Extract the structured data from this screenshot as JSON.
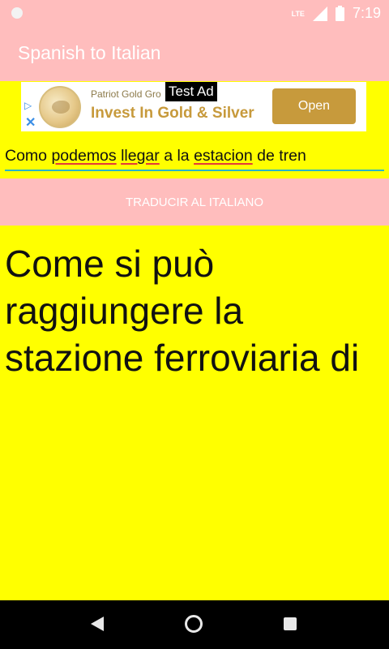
{
  "status_bar": {
    "time": "7:19",
    "network": "LTE"
  },
  "app_bar": {
    "title": "Spanish to Italian"
  },
  "ad": {
    "label": "Test Ad",
    "advertiser": "Patriot Gold Gro",
    "headline": "Invest In Gold & Silver",
    "cta": "Open"
  },
  "input": {
    "segments": [
      {
        "text": "Como ",
        "misspelled": false
      },
      {
        "text": "podemos",
        "misspelled": true
      },
      {
        "text": " ",
        "misspelled": false
      },
      {
        "text": "llegar",
        "misspelled": true
      },
      {
        "text": " a la ",
        "misspelled": false
      },
      {
        "text": "estacion",
        "misspelled": true
      },
      {
        "text": " de tren",
        "misspelled": false
      }
    ]
  },
  "translate_button": {
    "label": "TRADUCIR AL ITALIANO"
  },
  "result": {
    "text": "Come si può raggiungere la stazione ferroviaria di"
  },
  "colors": {
    "accent_pink": "#ffbdbd",
    "background": "#ffff00",
    "ad_gold": "#c79a3c",
    "underline": "#29b6c6"
  },
  "icons": [
    "signal-icon",
    "battery-icon",
    "back-icon",
    "home-icon",
    "recents-icon",
    "adchoices-icon",
    "close-icon"
  ]
}
